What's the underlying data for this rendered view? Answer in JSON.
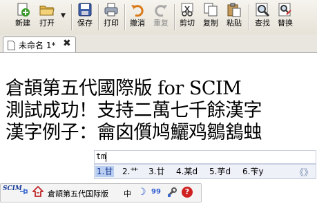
{
  "toolbar": {
    "new_label": "新建",
    "open_label": "打开",
    "save_label": "保存",
    "print_label": "打印",
    "undo_label": "撤消",
    "redo_label": "重复",
    "cut_label": "剪切",
    "copy_label": "复制",
    "paste_label": "粘贴",
    "find_label": "查找",
    "replace_label": "替换",
    "dropdown_glyph": "▼"
  },
  "tab": {
    "title": "未命名 1*",
    "close_glyph": "✖"
  },
  "editor": {
    "lines": [
      "倉頡第五代國際版 for SCIM",
      "測試成功！支持二萬七千餘漢字",
      "漢字例子：龠囟儨鸠鱺鸡鶵鵨䖵"
    ]
  },
  "ime": {
    "input": "tm",
    "candidates": [
      "1.甘",
      "2.艹",
      "3.廿",
      "4.某d",
      "5.芋d",
      "6.苄y"
    ],
    "prev_glyph": "《",
    "next_glyph": "》"
  },
  "status_bar": {
    "logo_text": "SCIM",
    "input_method": "倉頡第五代国际版",
    "mode": "中",
    "width_glyph": "☽",
    "punct_glyph": "99",
    "help_glyph": "?"
  }
}
